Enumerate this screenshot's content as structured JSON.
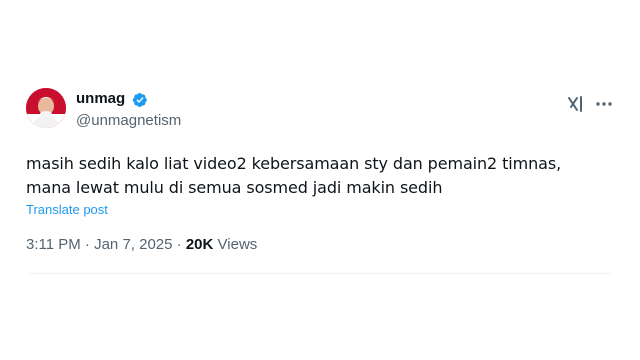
{
  "author": {
    "name": "unmag",
    "handle": "@unmagnetism",
    "verified": true
  },
  "tweet": {
    "lines": [
      "masih sedih kalo liat video2 kebersamaan sty dan pemain2 timnas,",
      "mana lewat mulu di semua sosmed jadi makin sedih"
    ],
    "translate_label": "Translate post"
  },
  "meta": {
    "time": "3:11 PM",
    "separator": "·",
    "date": "Jan 7, 2025",
    "views_count": "20K",
    "views_label": "Views"
  },
  "icons": {
    "verified": "verified-badge-icon",
    "grok": "grok-icon",
    "more": "more-options-icon"
  },
  "colors": {
    "text_primary": "#0f1419",
    "text_secondary": "#536471",
    "link": "#1d9bf0",
    "avatar_bg": "#c8102e"
  }
}
